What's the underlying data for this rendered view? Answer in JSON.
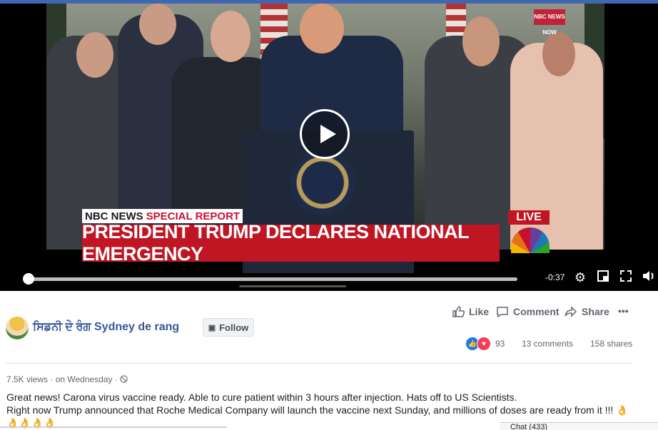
{
  "video": {
    "nbc_tag_brand": "NBC NEWS",
    "nbc_tag_label": "SPECIAL REPORT",
    "headline": "PRESIDENT TRUMP DECLARES NATIONAL EMERGENCY",
    "live_badge": "LIVE",
    "corner_logo": "NBC NEWS NOW",
    "time_remaining": "-0:37",
    "progress": 0.0
  },
  "post": {
    "page_name": "ਸਿਡਨੀ ਦੇ ਰੰਗ Sydney de rang",
    "follow_label": "Follow",
    "like_label": "Like",
    "comment_label": "Comment",
    "share_label": "Share",
    "more_label": "•••",
    "reaction_count": "93",
    "comments_count": "13 comments",
    "shares_count": "158 shares",
    "views": "7.5K views",
    "separator": "·",
    "posted_time": "on Wednesday",
    "caption_line1": "Great news! Carona virus vaccine ready. Able to cure patient within 3 hours after injection. Hats off to US Scientists.",
    "caption_line2": "Right now Trump announced that Roche Medical Company will launch the vaccine next Sunday, and millions of doses are ready from it !!! 👌",
    "caption_line3": "👌👌👌👌",
    "chat_label": "Chat (433)"
  },
  "colors": {
    "facebook_blue": "#4267b2",
    "link_blue": "#365899",
    "nbc_red": "#c01523"
  },
  "icons": [
    "play-icon",
    "settings-icon",
    "miniplayer-icon",
    "fullscreen-icon",
    "volume-icon",
    "like-icon",
    "comment-icon",
    "share-icon",
    "globe-icon",
    "follow-icon"
  ]
}
